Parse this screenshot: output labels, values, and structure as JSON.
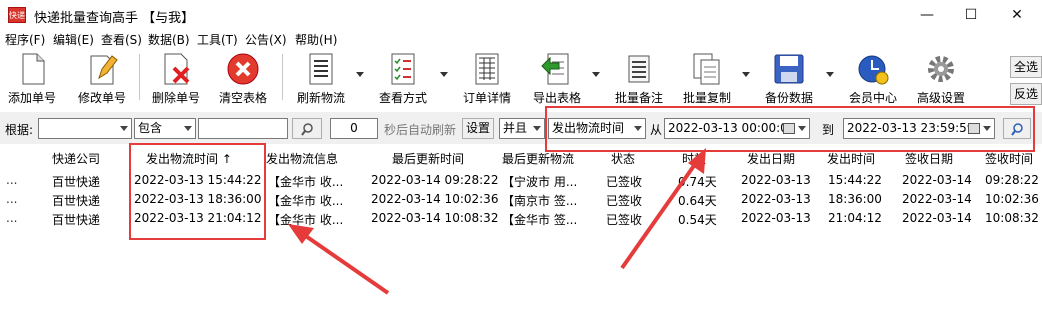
{
  "window": {
    "title": "快递批量查询高手 【与我】",
    "app_icon": "快递",
    "minimize": "—",
    "maximize": "☐",
    "close": "✕"
  },
  "menu": [
    "程序(F)",
    "编辑(E)",
    "查看(S)",
    "数据(B)",
    "工具(T)",
    "公告(X)",
    "帮助(H)"
  ],
  "toolbar": {
    "add": "添加单号",
    "edit": "修改单号",
    "delete": "删除单号",
    "clear": "清空表格",
    "refresh": "刷新物流",
    "view_mode": "查看方式",
    "order_detail": "订单详情",
    "export": "导出表格",
    "batch_note": "批量备注",
    "batch_copy": "批量复制",
    "backup": "备份数据",
    "vip": "会员中心",
    "advanced": "高级设置",
    "select_all": "全选",
    "invert": "反选"
  },
  "filter": {
    "by_label": "根据:",
    "field_value": "",
    "op_value": "包含",
    "search_value": "",
    "interval_value": "0",
    "auto_refresh_label": "秒后自动刷新",
    "settings_btn": "设置",
    "logic_value": "并且",
    "time_field_value": "发出物流时间",
    "from_label": "从",
    "from_value": "2022-03-13 00:00:00",
    "to_label": "到",
    "to_value": "2022-03-13 23:59:59"
  },
  "grid": {
    "headers": [
      "快递公司",
      "发出物流时间 ↑",
      "发出物流信息",
      "最后更新时间",
      "最后更新物流",
      "状态",
      "时效",
      "发出日期",
      "发出时间",
      "签收日期",
      "签收时间"
    ],
    "rows": [
      [
        "百世快递",
        "2022-03-13 15:44:22",
        "【金华市 收...",
        "2022-03-14 09:28:22",
        "【宁波市 用...",
        "已签收",
        "0.74天",
        "2022-03-13",
        "15:44:22",
        "2022-03-14",
        "09:28:22"
      ],
      [
        "百世快递",
        "2022-03-13 18:36:00",
        "【金华市 收...",
        "2022-03-14 10:02:36",
        "【南京市 签...",
        "已签收",
        "0.64天",
        "2022-03-13",
        "18:36:00",
        "2022-03-14",
        "10:02:36"
      ],
      [
        "百世快递",
        "2022-03-13 21:04:12",
        "【金华市 收...",
        "2022-03-14 10:08:32",
        "【金华市 签...",
        "已签收",
        "0.54天",
        "2022-03-13",
        "21:04:12",
        "2022-03-14",
        "10:08:32"
      ]
    ],
    "row_marker": "..."
  },
  "colors": {
    "highlight": "#e53b3b",
    "toolbar_bg": "#ffffff",
    "filter_bg": "#f0f0f0"
  }
}
